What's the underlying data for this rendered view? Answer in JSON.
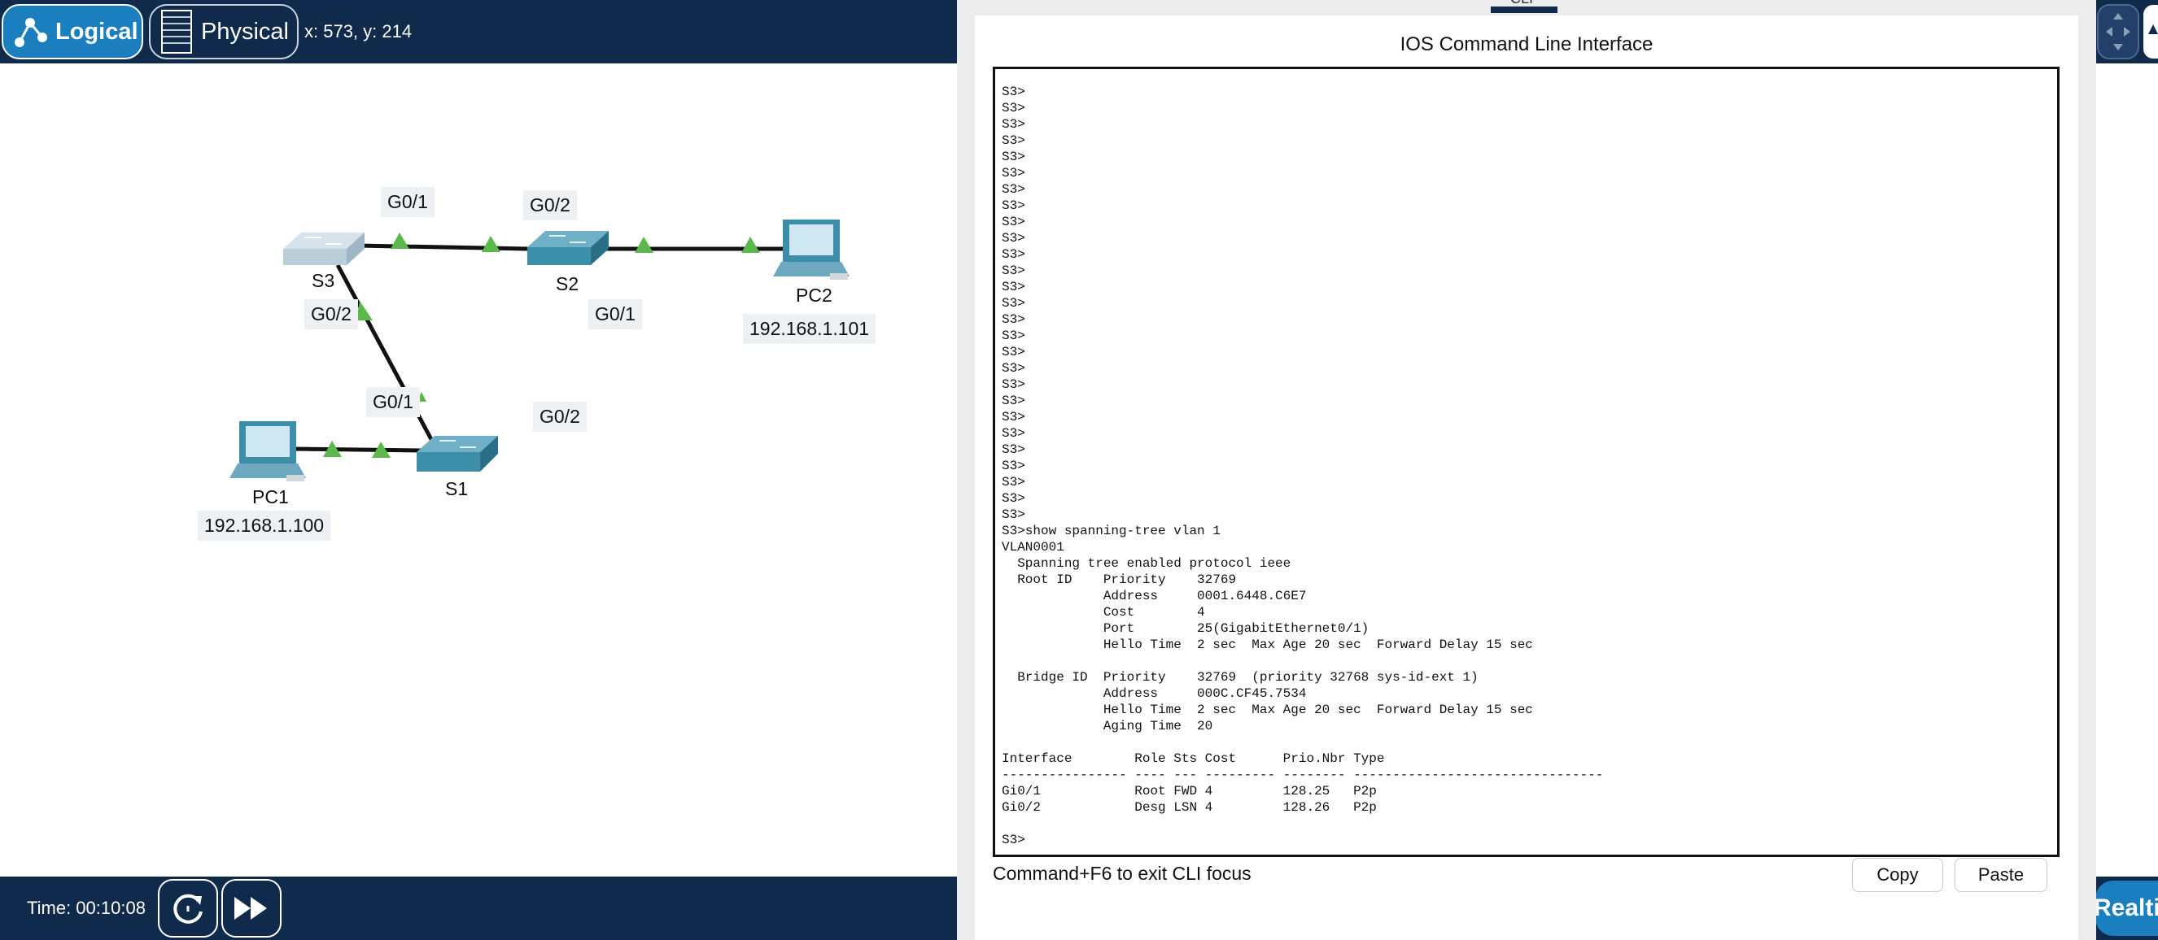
{
  "topbar": {
    "logical_label": "Logical",
    "physical_label": "Physical",
    "coords": "x: 573, y: 214"
  },
  "topology": {
    "devices": {
      "s3": "S3",
      "s2": "S2",
      "s1": "S1",
      "pc1": "PC1",
      "pc2": "PC2"
    },
    "ips": {
      "pc1": "192.168.1.100",
      "pc2": "192.168.1.101"
    },
    "ports": {
      "s3_g01": "G0/1",
      "s2_g02": "G0/2",
      "s2_g01": "G0/1",
      "s3_g02": "G0/2",
      "s1_g01": "G0/1",
      "s1_g02": "G0/2"
    },
    "colors": {
      "link": "#111111",
      "link_up": "#5bb84a",
      "switch_active": "#3d8ea8",
      "switch_inactive": "#b9ced9"
    }
  },
  "bottombar": {
    "time": "Time: 00:10:08",
    "realtime_label": "Realtime"
  },
  "cli": {
    "tab_label": "CLI",
    "title": "IOS Command Line Interface",
    "lines": [
      "S3>",
      "S3>",
      "S3>",
      "S3>",
      "S3>",
      "S3>",
      "S3>",
      "S3>",
      "S3>",
      "S3>",
      "S3>",
      "S3>",
      "S3>",
      "S3>",
      "S3>",
      "S3>",
      "S3>",
      "S3>",
      "S3>",
      "S3>",
      "S3>",
      "S3>",
      "S3>",
      "S3>",
      "S3>",
      "S3>",
      "S3>",
      "S3>show spanning-tree vlan 1",
      "VLAN0001",
      "  Spanning tree enabled protocol ieee",
      "  Root ID    Priority    32769",
      "             Address     0001.6448.C6E7",
      "             Cost        4",
      "             Port        25(GigabitEthernet0/1)",
      "             Hello Time  2 sec  Max Age 20 sec  Forward Delay 15 sec",
      "",
      "  Bridge ID  Priority    32769  (priority 32768 sys-id-ext 1)",
      "             Address     000C.CF45.7534",
      "             Hello Time  2 sec  Max Age 20 sec  Forward Delay 15 sec",
      "             Aging Time  20",
      "",
      "Interface        Role Sts Cost      Prio.Nbr Type",
      "---------------- ---- --- --------- -------- --------------------------------",
      "Gi0/1            Root FWD 4         128.25   P2p",
      "Gi0/2            Desg LSN 4         128.26   P2p",
      "",
      "S3>"
    ],
    "exit_hint": "Command+F6 to exit CLI focus",
    "copy_label": "Copy",
    "paste_label": "Paste"
  }
}
